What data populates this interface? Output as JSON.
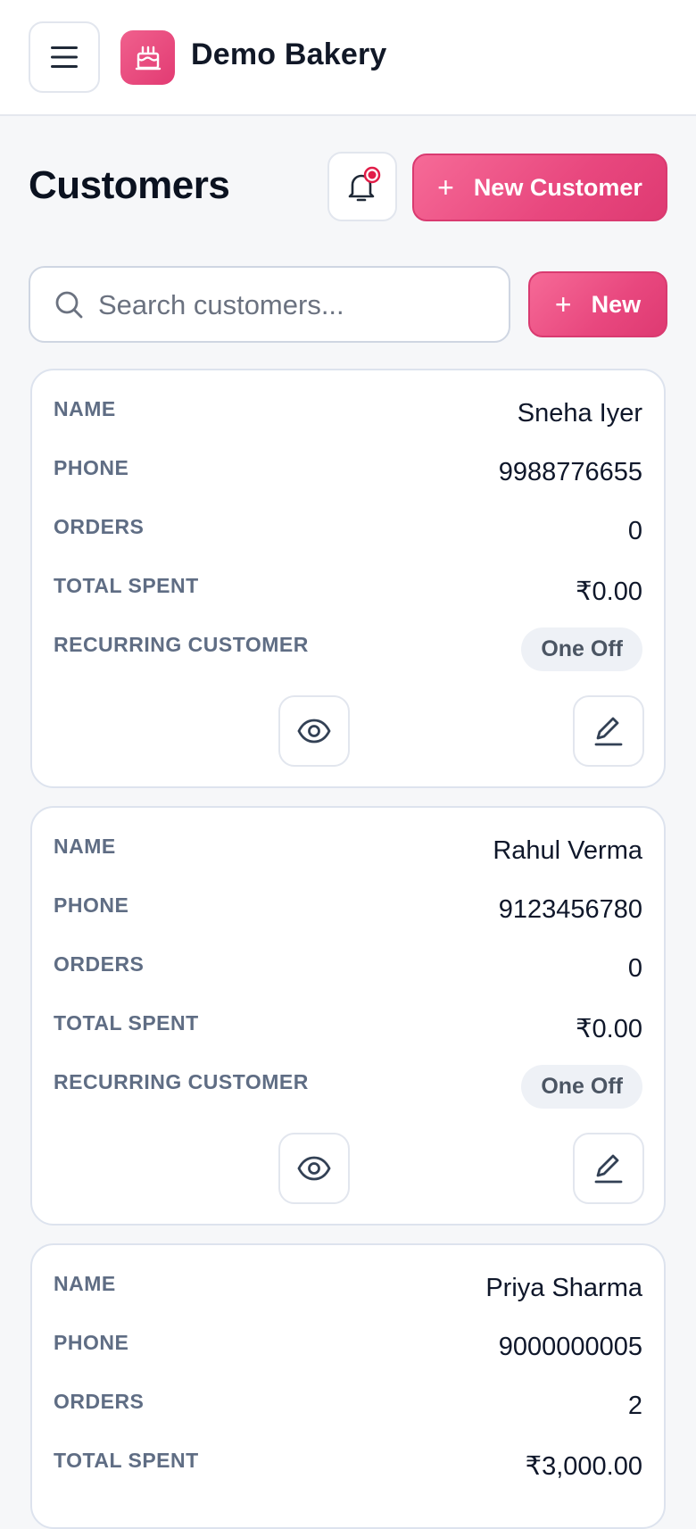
{
  "header": {
    "brand": "Demo Bakery"
  },
  "page": {
    "title": "Customers"
  },
  "actions": {
    "new_customer_label": "New Customer",
    "new_label": "New",
    "plus": "+"
  },
  "search": {
    "placeholder": "Search customers..."
  },
  "labels": {
    "name": "NAME",
    "phone": "PHONE",
    "orders": "ORDERS",
    "total_spent": "TOTAL SPENT",
    "recurring": "RECURRING CUSTOMER"
  },
  "customers": [
    {
      "name": "Sneha Iyer",
      "phone": "9988776655",
      "orders": "0",
      "total_spent": "₹0.00",
      "recurring": "One Off"
    },
    {
      "name": "Rahul Verma",
      "phone": "9123456780",
      "orders": "0",
      "total_spent": "₹0.00",
      "recurring": "One Off"
    },
    {
      "name": "Priya Sharma",
      "phone": "9000000005",
      "orders": "2",
      "total_spent": "₹3,000.00"
    }
  ],
  "colors": {
    "accent": "#e8477e",
    "label": "#5f6d84",
    "notification_dot": "#e11d48"
  },
  "icons": [
    "menu-icon",
    "cake-icon",
    "bell-icon",
    "search-icon",
    "eye-icon",
    "edit-icon"
  ]
}
